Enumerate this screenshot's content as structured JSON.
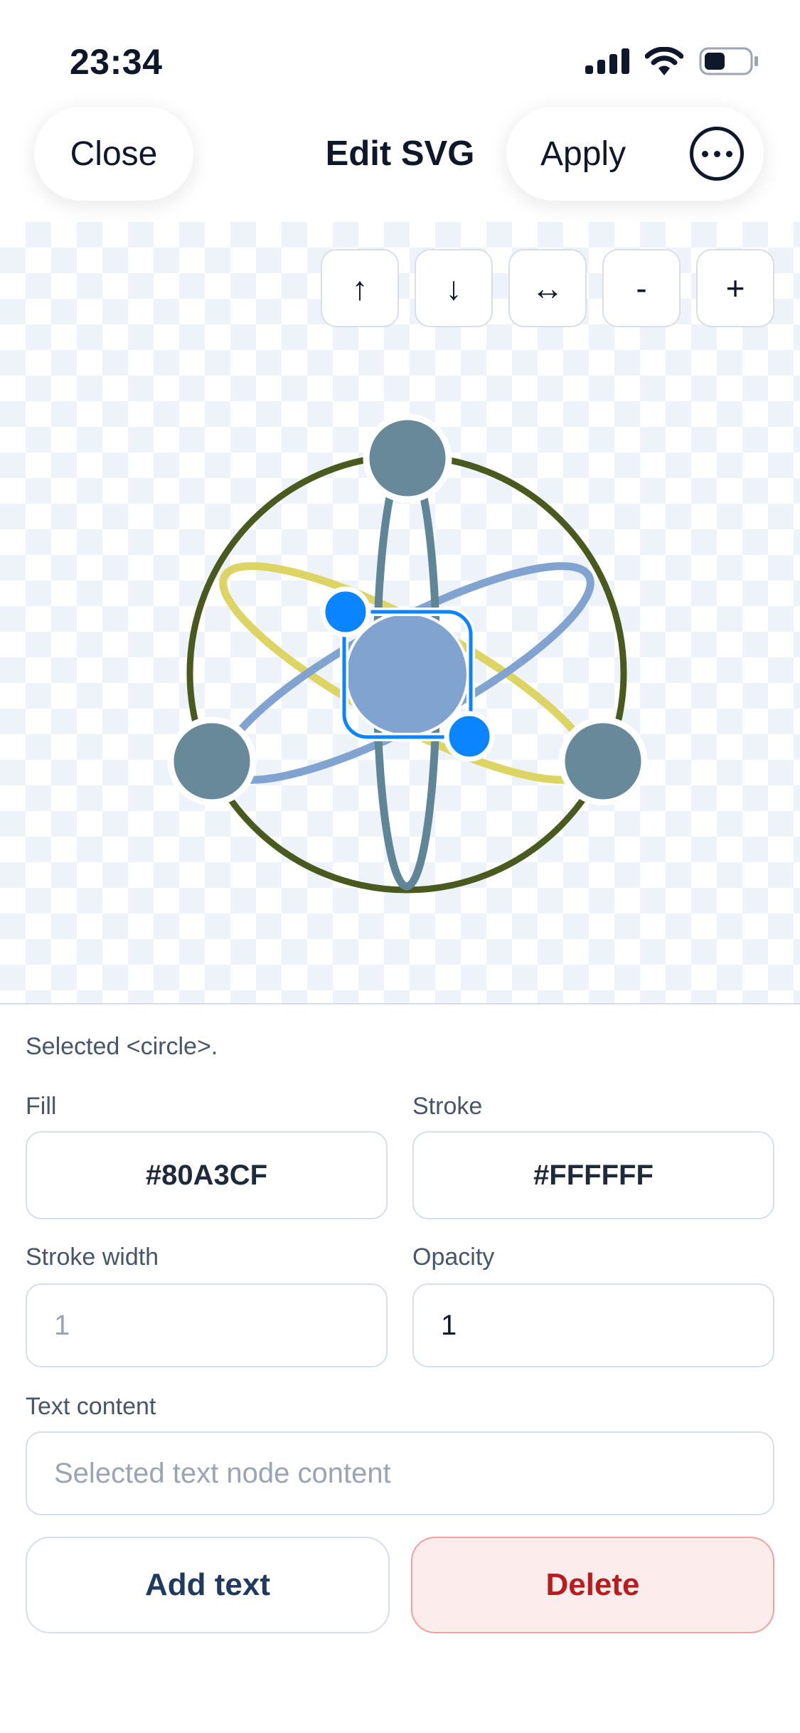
{
  "status_bar": {
    "time": "23:34"
  },
  "header": {
    "close_label": "Close",
    "title": "Edit SVG",
    "apply_label": "Apply"
  },
  "toolbar": {
    "move_up": "↑",
    "move_down": "↓",
    "flip": "↔",
    "zoom_out": "-",
    "zoom_in": "+"
  },
  "panel": {
    "selected_text": "Selected <circle>.",
    "fill_label": "Fill",
    "fill_value": "#80A3CF",
    "stroke_label": "Stroke",
    "stroke_value": "#FFFFFF",
    "stroke_width_label": "Stroke width",
    "stroke_width_placeholder": "1",
    "opacity_label": "Opacity",
    "opacity_value": "1",
    "text_content_label": "Text content",
    "text_content_placeholder": "Selected text node content",
    "add_text_label": "Add text",
    "delete_label": "Delete"
  },
  "colors": {
    "orbit_ring": "#4a5a1e",
    "orbit_yellow": "#dcd463",
    "orbit_blue": "#80a3cf",
    "orbit_slate": "#5f8596",
    "node": "#678999",
    "core": "#80A3CF",
    "selection": "#0a84ff",
    "delete_text": "#b91c1c"
  }
}
